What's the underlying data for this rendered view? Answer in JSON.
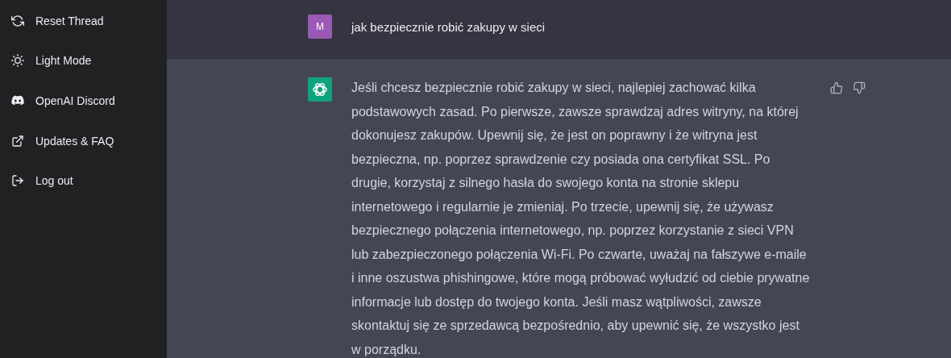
{
  "sidebar": {
    "items": [
      {
        "label": "Reset Thread",
        "kind": "reset"
      },
      {
        "label": "Light Mode",
        "kind": "theme"
      },
      {
        "label": "OpenAI Discord",
        "kind": "community"
      },
      {
        "label": "Updates & FAQ",
        "kind": "link"
      },
      {
        "label": "Log out",
        "kind": "logout"
      }
    ]
  },
  "conversation": [
    {
      "kind": "user",
      "avatar": "M",
      "text": "jak bezpiecznie robić zakupy w sieci"
    },
    {
      "kind": "assistant",
      "text": "Jeśli chcesz bezpiecznie robić zakupy w sieci, najlepiej zachować kilka podstawowych zasad. Po pierwsze, zawsze sprawdzaj adres witryny, na której dokonujesz zakupów. Upewnij się, że jest on poprawny i że witryna jest bezpieczna, np. poprzez sprawdzenie czy posiada ona certyfikat SSL. Po drugie, korzystaj z silnego hasła do swojego konta na stronie sklepu internetowego i regularnie je zmieniaj. Po trzecie, upewnij się, że używasz bezpiecznego połączenia internetowego, np. poprzez korzystanie z sieci VPN lub zabezpieczonego połączenia Wi-Fi. Po czwarte, uważaj na fałszywe e-maile i inne oszustwa phishingowe, które mogą próbować wyłudzić od ciebie prywatne informacje lub dostęp do twojego konta. Jeśli masz wątpliwości, zawsze skontaktuj się ze sprzedawcą bezpośrednio, aby upewnić się, że wszystko jest w porządku."
    }
  ]
}
